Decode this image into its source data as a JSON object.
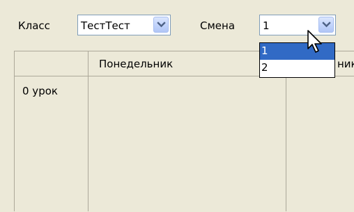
{
  "toolbar": {
    "class_label": "Класс",
    "class_value": "ТестТест",
    "shift_label": "Смена",
    "shift_value": "1",
    "shift_options": [
      "1",
      "2"
    ],
    "shift_selected_index": 0
  },
  "schedule": {
    "columns": [
      "",
      "Понедельник",
      "ник"
    ],
    "rows": [
      {
        "label": "0 урок"
      }
    ]
  },
  "icons": {
    "dropdown": "chevron-down-icon",
    "cursor": "mouse-pointer-icon"
  },
  "colors": {
    "selection": "#316ac5",
    "window_bg": "#ece9d8"
  }
}
